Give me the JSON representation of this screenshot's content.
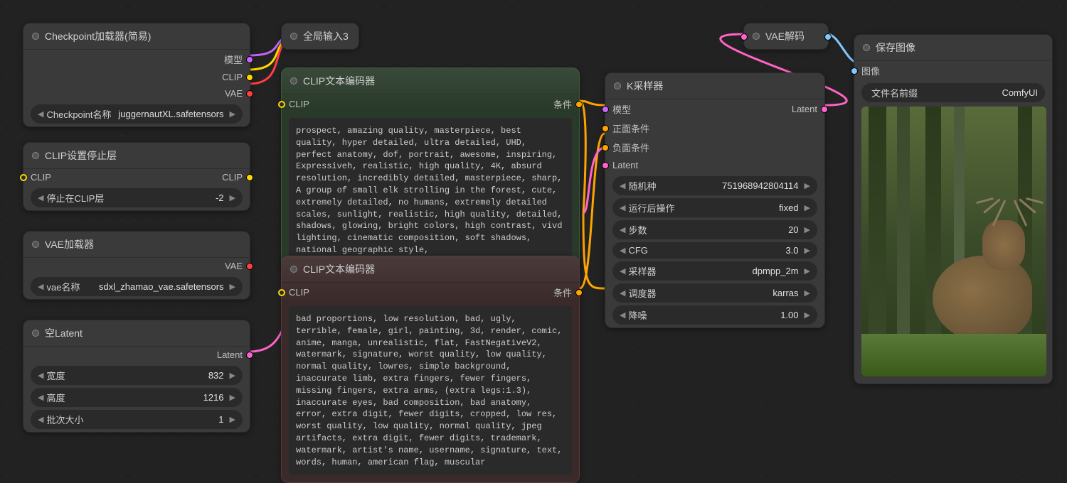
{
  "nodes": {
    "checkpoint_loader": {
      "title": "Checkpoint加载器(简易)",
      "outputs": {
        "model": "模型",
        "clip": "CLIP",
        "vae": "VAE"
      },
      "widget": {
        "label": "Checkpoint名称",
        "value": "juggernautXL.safetensors"
      }
    },
    "clip_stop_layer": {
      "title": "CLIP设置停止层",
      "inputs": {
        "clip": "CLIP"
      },
      "outputs": {
        "clip": "CLIP"
      },
      "widget": {
        "label": "停止在CLIP层",
        "value": "-2"
      }
    },
    "vae_loader": {
      "title": "VAE加载器",
      "outputs": {
        "vae": "VAE"
      },
      "widget": {
        "label": "vae名称",
        "value": "sdxl_zhamao_vae.safetensors"
      }
    },
    "empty_latent": {
      "title": "空Latent",
      "outputs": {
        "latent": "Latent"
      },
      "widgets": [
        {
          "label": "宽度",
          "value": "832"
        },
        {
          "label": "高度",
          "value": "1216"
        },
        {
          "label": "批次大小",
          "value": "1"
        }
      ]
    },
    "global_input3": {
      "title": "全局输入3"
    },
    "clip_text_pos": {
      "title": "CLIP文本编码器",
      "inputs": {
        "clip": "CLIP"
      },
      "outputs": {
        "cond": "条件"
      },
      "text": "prospect, amazing quality, masterpiece, best quality, hyper detailed, ultra detailed, UHD, perfect anatomy, dof, portrait, awesome, inspiring,  Expressiveh, realistic, high quality, 4K, absurd resolution, incredibly detailed, masterpiece, sharp, A group of small elk strolling in the forest, cute, extremely detailed, no humans, extremely detailed scales, sunlight, realistic, high quality, detailed, shadows, glowing, bright colors, high contrast, vivd lighting, cinematic composition, soft shadows, national geographic style,"
    },
    "clip_text_neg": {
      "title": "CLIP文本编码器",
      "inputs": {
        "clip": "CLIP"
      },
      "outputs": {
        "cond": "条件"
      },
      "text": "bad proportions, low resolution, bad, ugly, terrible, female, girl, painting, 3d, render, comic, anime, manga, unrealistic, flat, FastNegativeV2, watermark, signature, worst quality, low quality, normal quality, lowres, simple background, inaccurate limb, extra fingers, fewer fingers, missing fingers, extra arms, (extra legs:1.3), inaccurate eyes, bad composition, bad anatomy, error, extra digit, fewer digits, cropped, low res, worst quality, low quality, normal quality, jpeg artifacts, extra digit, fewer digits, trademark, watermark, artist's name, username, signature, text, words, human, american flag, muscular"
    },
    "ksampler": {
      "title": "K采样器",
      "inputs": {
        "model": "模型",
        "pos": "正面条件",
        "neg": "负面条件",
        "latent": "Latent"
      },
      "outputs": {
        "latent": "Latent"
      },
      "widgets": [
        {
          "label": "随机种",
          "value": "751968942804114"
        },
        {
          "label": "运行后操作",
          "value": "fixed"
        },
        {
          "label": "步数",
          "value": "20"
        },
        {
          "label": "CFG",
          "value": "3.0"
        },
        {
          "label": "采样器",
          "value": "dpmpp_2m"
        },
        {
          "label": "调度器",
          "value": "karras"
        },
        {
          "label": "降噪",
          "value": "1.00"
        }
      ]
    },
    "vae_decode": {
      "title": "VAE解码",
      "inputs": {
        "samples": "",
        "vae": ""
      },
      "outputs": {
        "image": ""
      }
    },
    "save_image": {
      "title": "保存图像",
      "inputs": {
        "image": "图像"
      },
      "widget": {
        "label": "文件名前缀",
        "value": "ComfyUI"
      }
    }
  }
}
